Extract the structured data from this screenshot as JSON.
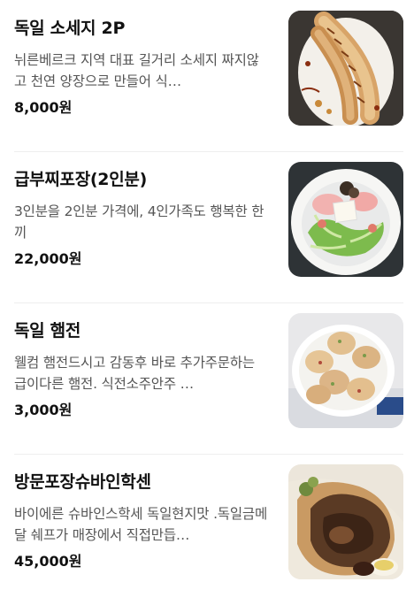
{
  "menu": {
    "items": [
      {
        "name": "독일 소세지 2P",
        "description": "뉘른베르크 지역 대표 길거리 소세지 짜지않고 천연 양장으로 만들어 식…",
        "price": "8,000원",
        "image_icon": "sausage-photo"
      },
      {
        "name": "급부찌포장(2인분)",
        "description": "3인분을 2인분 가격에, 4인가족도 행복한 한끼",
        "price": "22,000원",
        "image_icon": "budae-jjigae-photo"
      },
      {
        "name": "독일 햄전",
        "description": "웰컴 햄전드시고 감동후 바로 추가주문하는 급이다른 햄전. 식전소주안주 …",
        "price": "3,000원",
        "image_icon": "ham-pancake-photo"
      },
      {
        "name": "방문포장슈바인학센",
        "description": "바이에른 슈바인스학세 독일현지맛 .독일금메달 쉐프가 매장에서 직접만듭…",
        "price": "45,000원",
        "image_icon": "schweinshaxe-photo"
      }
    ]
  },
  "colors": {
    "title": "#111111",
    "description": "#555555",
    "divider": "#eeeeee"
  }
}
